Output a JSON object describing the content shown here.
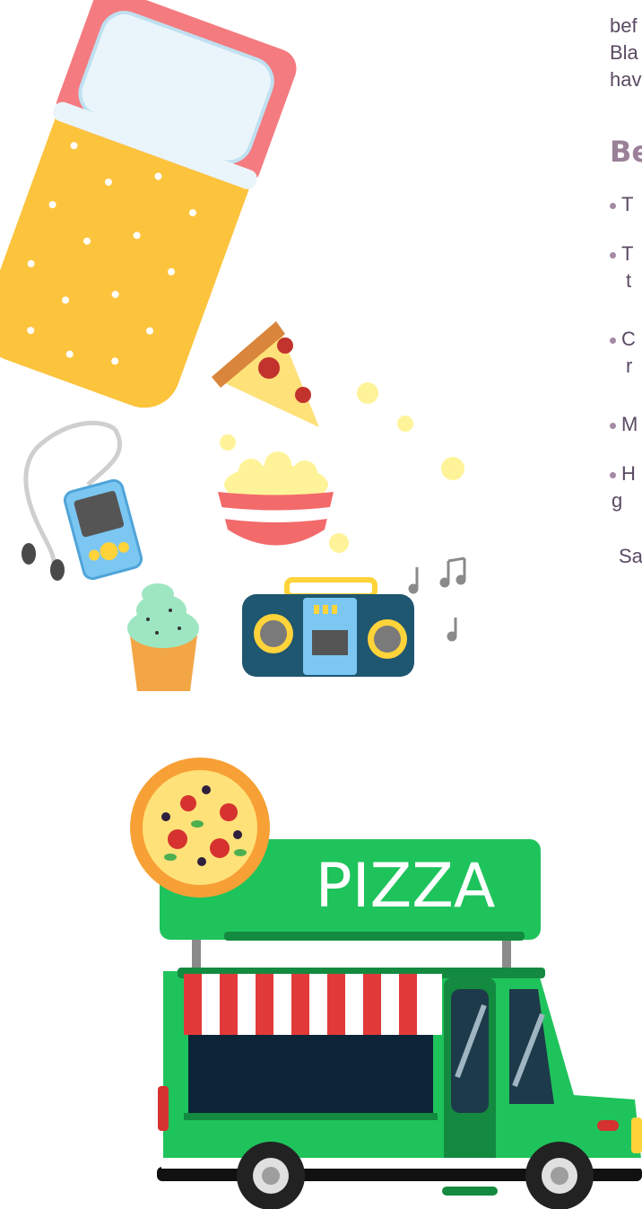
{
  "paragraph_lines": [
    "bef",
    "Bla",
    "hav"
  ],
  "heading": "Be",
  "bullets": [
    {
      "first": "T",
      "second": ""
    },
    {
      "first": "T",
      "second": "t"
    },
    {
      "first": "C",
      "second": "r"
    },
    {
      "first": "M",
      "second": ""
    },
    {
      "first": "H",
      "second": "g"
    }
  ],
  "closing": "Sa",
  "truck_sign": "PIZZA",
  "colors": {
    "heading": "#9b8099",
    "body_text": "#5a4a63",
    "truck_green": "#1fc35c",
    "truck_dark_green": "#138a3f",
    "sleeping_bag": "#fcc43d",
    "pillow_case": "#f47b7f"
  }
}
